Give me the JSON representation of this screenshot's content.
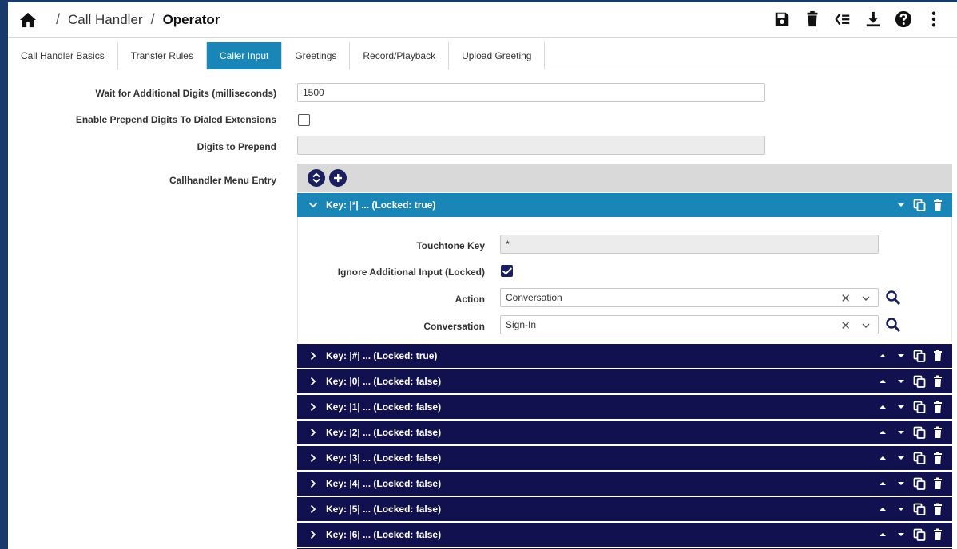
{
  "breadcrumb": {
    "section": "Call Handler",
    "current": "Operator",
    "separator": "/"
  },
  "header_actions": [
    "save-icon",
    "delete-icon",
    "reorder-icon",
    "download-icon",
    "help-icon",
    "more-icon"
  ],
  "tabs": [
    {
      "label": "Call Handler Basics",
      "active": false
    },
    {
      "label": "Transfer Rules",
      "active": false
    },
    {
      "label": "Caller Input",
      "active": true
    },
    {
      "label": "Greetings",
      "active": false
    },
    {
      "label": "Record/Playback",
      "active": false
    },
    {
      "label": "Upload Greeting",
      "active": false
    }
  ],
  "form": {
    "wait_label": "Wait for Additional Digits (milliseconds)",
    "wait_value": "1500",
    "prepend_enable_label": "Enable Prepend Digits To Dialed Extensions",
    "prepend_enabled": false,
    "prepend_digits_label": "Digits to Prepend",
    "prepend_digits_value": "",
    "menu_entry_label": "Callhandler Menu Entry"
  },
  "open_entry": {
    "title": "Key: |*| ... (Locked: true)",
    "touchtone_label": "Touchtone Key",
    "touchtone_value": "*",
    "ignore_label": "Ignore Additional Input (Locked)",
    "ignore_checked": true,
    "action_label": "Action",
    "action_value": "Conversation",
    "conversation_label": "Conversation",
    "conversation_value": "Sign-In",
    "clear_glyph": "✕"
  },
  "entries": [
    "Key: |#| ... (Locked: true)",
    "Key: |0| ... (Locked: false)",
    "Key: |1| ... (Locked: false)",
    "Key: |2| ... (Locked: false)",
    "Key: |3| ... (Locked: false)",
    "Key: |4| ... (Locked: false)",
    "Key: |5| ... (Locked: false)",
    "Key: |6| ... (Locked: false)"
  ],
  "colors": {
    "accent": "#1a86b8",
    "entry_bg": "#12114f",
    "frame": "#1a3a6b"
  }
}
